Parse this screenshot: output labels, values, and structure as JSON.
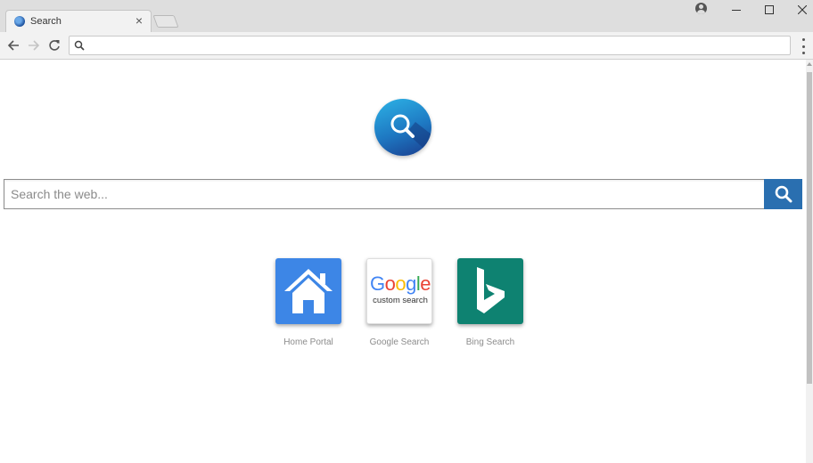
{
  "browser": {
    "tab_title": "Search",
    "tab_close": "×",
    "address_value": ""
  },
  "page": {
    "search_placeholder": "Search the web...",
    "shortcuts": [
      {
        "label": "Home Portal",
        "icon": "house-icon"
      },
      {
        "label": "Google Search",
        "icon": "google-custom-search-logo",
        "logo_text": "Google",
        "logo_sub": "custom search"
      },
      {
        "label": "Bing Search",
        "icon": "bing-logo"
      }
    ]
  },
  "colors": {
    "accent": "#2a6fb0",
    "home_tile": "#3d86e6",
    "bing_tile": "#0e8271"
  }
}
